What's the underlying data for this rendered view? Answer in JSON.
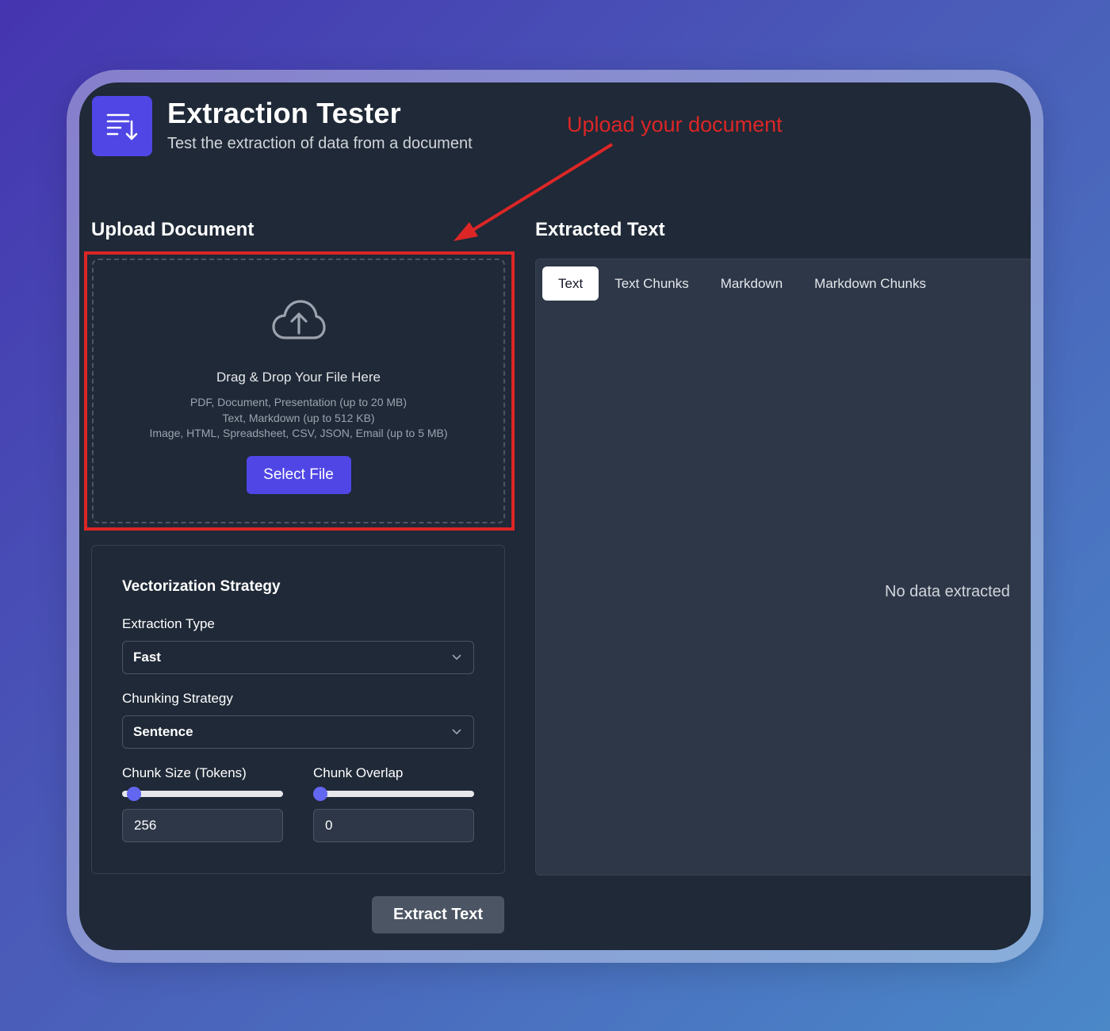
{
  "app": {
    "title": "Extraction Tester",
    "subtitle": "Test the extraction of data from a document",
    "icon": "list-download-icon"
  },
  "annotation": {
    "text": "Upload your document",
    "color": "#dc2626"
  },
  "upload": {
    "heading": "Upload Document",
    "drop_title": "Drag & Drop Your File Here",
    "hints": [
      "PDF, Document, Presentation (up to 20 MB)",
      "Text, Markdown (up to 512 KB)",
      "Image, HTML, Spreadsheet, CSV, JSON, Email (up to 5 MB)"
    ],
    "select_label": "Select File",
    "icon": "cloud-upload-icon"
  },
  "vectorization": {
    "title": "Vectorization Strategy",
    "extraction_type": {
      "label": "Extraction Type",
      "value": "Fast"
    },
    "chunking_strategy": {
      "label": "Chunking Strategy",
      "value": "Sentence"
    },
    "chunk_size": {
      "label": "Chunk Size (Tokens)",
      "value": "256",
      "slider_fraction": 0.03
    },
    "chunk_overlap": {
      "label": "Chunk Overlap",
      "value": "0",
      "slider_fraction": 0.0
    }
  },
  "actions": {
    "extract_label": "Extract Text"
  },
  "output": {
    "heading": "Extracted Text",
    "tabs": [
      {
        "label": "Text",
        "active": true
      },
      {
        "label": "Text Chunks",
        "active": false
      },
      {
        "label": "Markdown",
        "active": false
      },
      {
        "label": "Markdown Chunks",
        "active": false
      }
    ],
    "empty_message": "No data extracted"
  },
  "colors": {
    "accent": "#4f46e5",
    "panel_bg": "#1f2937",
    "output_bg": "#2d3748",
    "slider_thumb": "#6366f1"
  }
}
